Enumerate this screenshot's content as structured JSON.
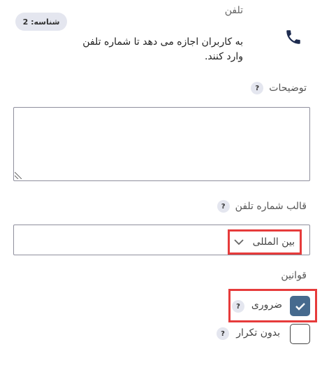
{
  "field": {
    "id_badge": "شناسه: 2",
    "name": "تلفن",
    "description": "به کاربران اجازه می دهد تا شماره تلفن وارد کنند.",
    "icon": "phone-icon"
  },
  "description_section": {
    "label": "توضیحات",
    "help": "?",
    "value": ""
  },
  "format_section": {
    "label": "قالب شماره تلفن",
    "help": "?",
    "selected": "بین المللی"
  },
  "rules_section": {
    "title": "قوانین",
    "rules": [
      {
        "label": "ضروری",
        "help": "?",
        "checked": true
      },
      {
        "label": "بدون تکرار",
        "help": "?",
        "checked": false
      }
    ]
  },
  "colors": {
    "checkbox_checked": "#466a8e",
    "highlight": "#e63b3b",
    "badge_bg": "#e4e6ef",
    "phone_icon": "#1d2b4f"
  }
}
